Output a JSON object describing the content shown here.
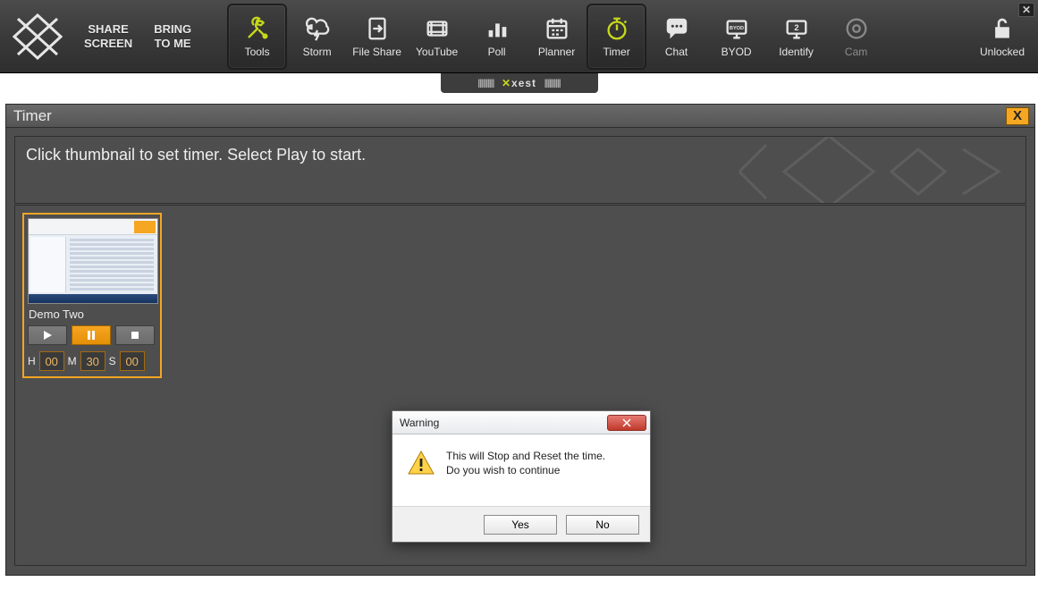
{
  "colors": {
    "accent": "#c7d81b",
    "orange": "#f5a623"
  },
  "topbar": {
    "share": "SHARE\nSCREEN",
    "bring": "BRING\nTO ME",
    "tools": [
      {
        "id": "tools",
        "label": "Tools",
        "selected": true
      },
      {
        "id": "storm",
        "label": "Storm"
      },
      {
        "id": "fileshare",
        "label": "File Share"
      },
      {
        "id": "youtube",
        "label": "YouTube"
      },
      {
        "id": "poll",
        "label": "Poll"
      },
      {
        "id": "planner",
        "label": "Planner"
      },
      {
        "id": "timer",
        "label": "Timer",
        "selected": true
      },
      {
        "id": "chat",
        "label": "Chat"
      },
      {
        "id": "byod",
        "label": "BYOD"
      },
      {
        "id": "identify",
        "label": "Identify"
      },
      {
        "id": "cam",
        "label": "Cam",
        "disabled": true
      }
    ],
    "lock_label": "Unlocked"
  },
  "handle_brand": "xest",
  "panel": {
    "title": "Timer",
    "close_label": "X",
    "instruction": "Click thumbnail to set timer. Select Play to start.",
    "card": {
      "caption": "Demo Two",
      "h_label": "H",
      "m_label": "M",
      "s_label": "S",
      "h": "00",
      "m": "30",
      "s": "00"
    }
  },
  "dialog": {
    "title": "Warning",
    "line1": "This will Stop and Reset the time.",
    "line2": "Do you wish to continue",
    "yes": "Yes",
    "no": "No"
  }
}
